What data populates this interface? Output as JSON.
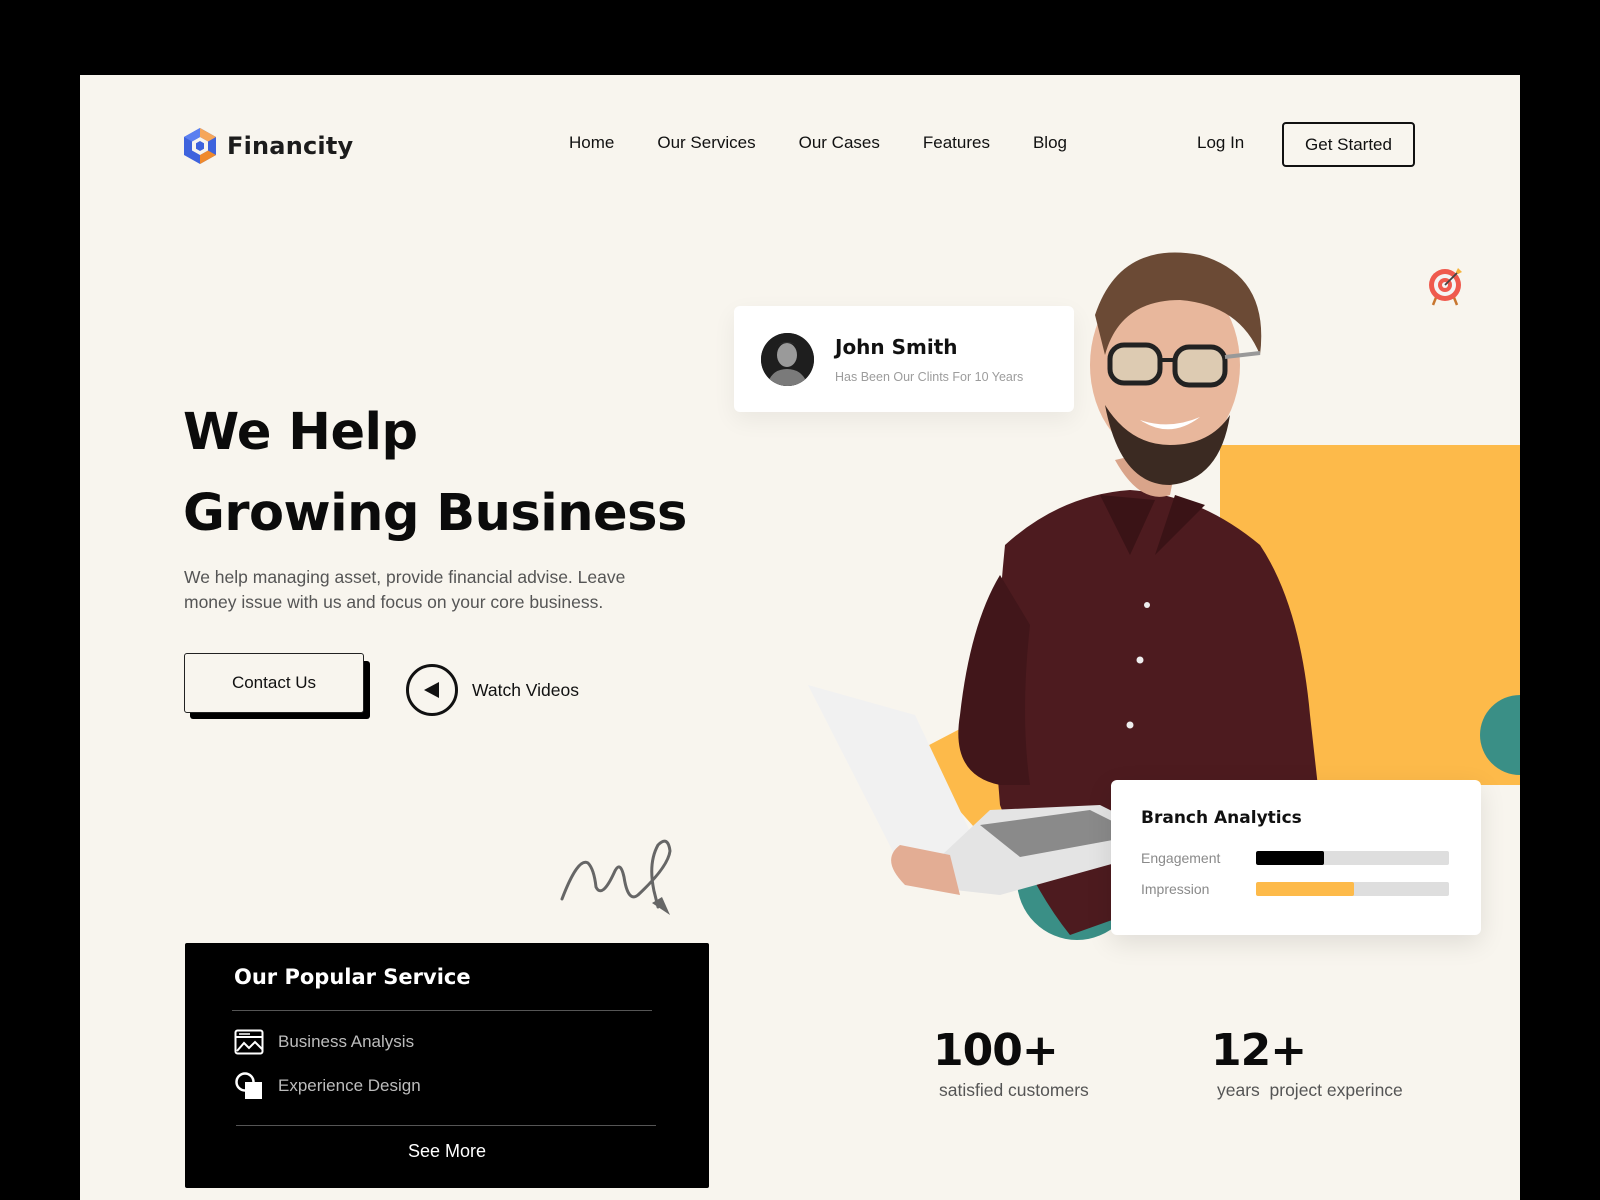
{
  "brand": {
    "name": "Financity",
    "logo_icon": "hexagon-c-logo-icon",
    "colors": {
      "blue": "#3e63dd",
      "orange": "#f08a2c",
      "yellow": "#fdba4a",
      "teal": "#3a8f86",
      "background": "#f8f5ee"
    }
  },
  "nav": {
    "items": [
      {
        "label": "Home"
      },
      {
        "label": "Our Services"
      },
      {
        "label": "Our Cases"
      },
      {
        "label": "Features"
      },
      {
        "label": "Blog"
      }
    ],
    "login_label": "Log In",
    "cta_label": "Get Started"
  },
  "hero": {
    "title_line1": "We Help",
    "title_line2": "Growing Business",
    "description": "We help managing asset, provide financial advise. Leave money issue with us and focus on your core business.",
    "contact_label": "Contact Us",
    "watch_label": "Watch Videos",
    "watch_icon": "play-icon"
  },
  "client_card": {
    "name": "John Smith",
    "subtitle": "Has Been Our Clints For 10 Years"
  },
  "analytics": {
    "title": "Branch Analytics",
    "metrics": [
      {
        "label": "Engagement",
        "value": 0.35,
        "color": "#000000"
      },
      {
        "label": "Impression",
        "value": 0.51,
        "color": "#fdba4a"
      }
    ]
  },
  "services": {
    "title": "Our Popular Service",
    "items": [
      {
        "label": "Business Analysis",
        "icon": "analytics-window-icon"
      },
      {
        "label": "Experience Design",
        "icon": "shapes-icon"
      }
    ],
    "see_more_label": "See More"
  },
  "stats": [
    {
      "value": "100+",
      "label": "satisfied customers"
    },
    {
      "value": "12+",
      "label": "years  project experince"
    }
  ]
}
